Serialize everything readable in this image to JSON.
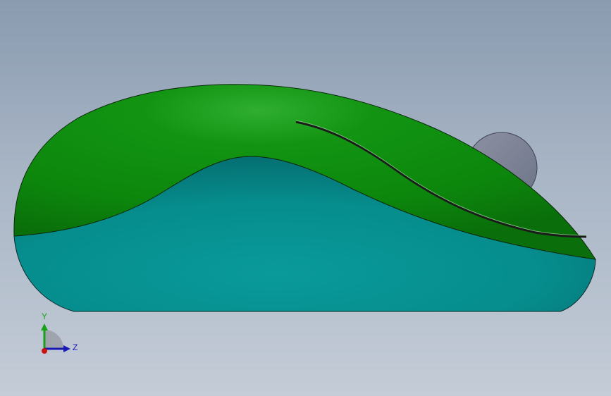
{
  "triad": {
    "y_label": "Y",
    "z_label": "Z"
  },
  "colors": {
    "shell_top": "#0e8d0e",
    "shell_bottom": "#079090",
    "scroll_wheel": "#7d8396",
    "axis_y": "#1aa11a",
    "axis_z": "#1a1ab4",
    "axis_x": "#cc1111"
  },
  "icons": {
    "triad": "coordinate-triad-icon"
  }
}
